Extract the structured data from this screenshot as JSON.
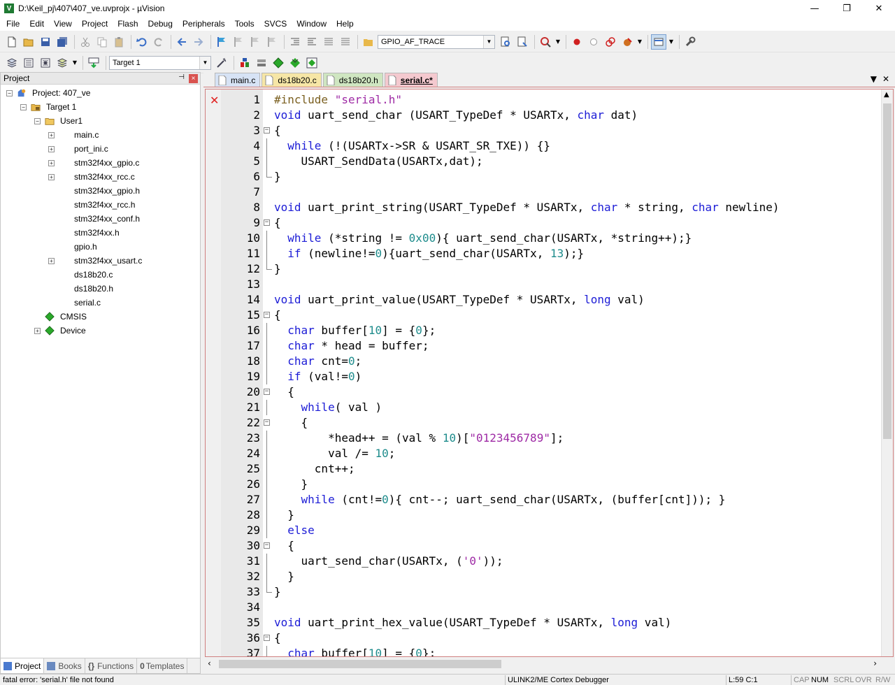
{
  "window": {
    "title": "D:\\Keil_pj\\407\\407_ve.uvprojx - µVision",
    "app_icon_letter": "V",
    "min": "—",
    "max": "❐",
    "close": "✕"
  },
  "menu": [
    "File",
    "Edit",
    "View",
    "Project",
    "Flash",
    "Debug",
    "Peripherals",
    "Tools",
    "SVCS",
    "Window",
    "Help"
  ],
  "toolbar1": {
    "find_combo": "GPIO_AF_TRACE"
  },
  "toolbar2": {
    "target_combo": "Target 1"
  },
  "project_panel": {
    "title": "Project",
    "pin": "⊣",
    "close": "×",
    "tree": {
      "root": "Project: 407_ve",
      "target": "Target 1",
      "group": "User1",
      "files": [
        "main.c",
        "port_ini.c",
        "stm32f4xx_gpio.c",
        "stm32f4xx_rcc.c",
        "stm32f4xx_gpio.h",
        "stm32f4xx_rcc.h",
        "stm32f4xx_conf.h",
        "stm32f4xx.h",
        "gpio.h",
        "stm32f4xx_usart.c",
        "ds18b20.c",
        "ds18b20.h",
        "serial.c"
      ],
      "components": [
        "CMSIS",
        "Device"
      ]
    },
    "tabs": [
      "Project",
      "Books",
      "Functions",
      "Templates"
    ]
  },
  "editor": {
    "tabs": [
      "main.c",
      "ds18b20.c",
      "ds18b20.h",
      "serial.c*"
    ],
    "active_tab": "serial.c*",
    "error_marker": "✕",
    "fold_open": "−",
    "code": [
      [
        [
          "p",
          "#include "
        ],
        [
          "s",
          "\"serial.h\""
        ]
      ],
      [
        [
          "k",
          "void"
        ],
        [
          "t",
          " uart_send_char (USART_TypeDef * USARTx, "
        ],
        [
          "k",
          "char"
        ],
        [
          "t",
          " dat)"
        ]
      ],
      [
        [
          "t",
          "{"
        ]
      ],
      [
        [
          "t",
          "  "
        ],
        [
          "k",
          "while"
        ],
        [
          "t",
          " (!(USARTx->SR & USART_SR_TXE)) {}"
        ]
      ],
      [
        [
          "t",
          "    USART_SendData(USARTx,dat);"
        ]
      ],
      [
        [
          "t",
          "}"
        ]
      ],
      [
        [
          "t",
          ""
        ]
      ],
      [
        [
          "k",
          "void"
        ],
        [
          "t",
          " uart_print_string(USART_TypeDef * USARTx, "
        ],
        [
          "k",
          "char"
        ],
        [
          "t",
          " * string, "
        ],
        [
          "k",
          "char"
        ],
        [
          "t",
          " newline)"
        ]
      ],
      [
        [
          "t",
          "{"
        ]
      ],
      [
        [
          "t",
          "  "
        ],
        [
          "k",
          "while"
        ],
        [
          "t",
          " (*string != "
        ],
        [
          "n",
          "0x00"
        ],
        [
          "t",
          "){ uart_send_char(USARTx, *string++);}"
        ]
      ],
      [
        [
          "t",
          "  "
        ],
        [
          "k",
          "if"
        ],
        [
          "t",
          " (newline!="
        ],
        [
          "n",
          "0"
        ],
        [
          "t",
          "){uart_send_char(USARTx, "
        ],
        [
          "n",
          "13"
        ],
        [
          "t",
          ");}"
        ]
      ],
      [
        [
          "t",
          "}"
        ]
      ],
      [
        [
          "t",
          ""
        ]
      ],
      [
        [
          "k",
          "void"
        ],
        [
          "t",
          " uart_print_value(USART_TypeDef * USARTx, "
        ],
        [
          "k",
          "long"
        ],
        [
          "t",
          " val)"
        ]
      ],
      [
        [
          "t",
          "{"
        ]
      ],
      [
        [
          "t",
          "  "
        ],
        [
          "k",
          "char"
        ],
        [
          "t",
          " buffer["
        ],
        [
          "n",
          "10"
        ],
        [
          "t",
          "] = {"
        ],
        [
          "n",
          "0"
        ],
        [
          "t",
          "};"
        ]
      ],
      [
        [
          "t",
          "  "
        ],
        [
          "k",
          "char"
        ],
        [
          "t",
          " * head = buffer;"
        ]
      ],
      [
        [
          "t",
          "  "
        ],
        [
          "k",
          "char"
        ],
        [
          "t",
          " cnt="
        ],
        [
          "n",
          "0"
        ],
        [
          "t",
          ";"
        ]
      ],
      [
        [
          "t",
          "  "
        ],
        [
          "k",
          "if"
        ],
        [
          "t",
          " (val!="
        ],
        [
          "n",
          "0"
        ],
        [
          "t",
          ")"
        ]
      ],
      [
        [
          "t",
          "  {"
        ]
      ],
      [
        [
          "t",
          "    "
        ],
        [
          "k",
          "while"
        ],
        [
          "t",
          "( val )"
        ]
      ],
      [
        [
          "t",
          "    {"
        ]
      ],
      [
        [
          "t",
          "        *head++ = (val % "
        ],
        [
          "n",
          "10"
        ],
        [
          "t",
          ")["
        ],
        [
          "s",
          "\"0123456789\""
        ],
        [
          "t",
          "];"
        ]
      ],
      [
        [
          "t",
          "        val /= "
        ],
        [
          "n",
          "10"
        ],
        [
          "t",
          ";"
        ]
      ],
      [
        [
          "t",
          "      cnt++;"
        ]
      ],
      [
        [
          "t",
          "    }"
        ]
      ],
      [
        [
          "t",
          "    "
        ],
        [
          "k",
          "while"
        ],
        [
          "t",
          " (cnt!="
        ],
        [
          "n",
          "0"
        ],
        [
          "t",
          "){ cnt--; uart_send_char(USARTx, (buffer[cnt])); }"
        ]
      ],
      [
        [
          "t",
          "  }"
        ]
      ],
      [
        [
          "t",
          "  "
        ],
        [
          "k",
          "else"
        ]
      ],
      [
        [
          "t",
          "  {"
        ]
      ],
      [
        [
          "t",
          "    uart_send_char(USARTx, ("
        ],
        [
          "s",
          "'0'"
        ],
        [
          "t",
          "));"
        ]
      ],
      [
        [
          "t",
          "  }"
        ]
      ],
      [
        [
          "t",
          "}"
        ]
      ],
      [
        [
          "t",
          ""
        ]
      ],
      [
        [
          "k",
          "void"
        ],
        [
          "t",
          " uart_print_hex_value(USART_TypeDef * USARTx, "
        ],
        [
          "k",
          "long"
        ],
        [
          "t",
          " val)"
        ]
      ],
      [
        [
          "t",
          "{"
        ]
      ],
      [
        [
          "t",
          "  "
        ],
        [
          "k",
          "char"
        ],
        [
          "t",
          " buffer["
        ],
        [
          "n",
          "10"
        ],
        [
          "t",
          "] = {"
        ],
        [
          "n",
          "0"
        ],
        [
          "t",
          "};"
        ]
      ]
    ]
  },
  "status": {
    "message": "fatal error: 'serial.h' file not found",
    "debugger": "ULINK2/ME Cortex Debugger",
    "position": "L:59 C:1",
    "caps": "CAP",
    "num": "NUM",
    "scrl": "SCRL",
    "ovr": "OVR",
    "rw": "R/W"
  }
}
